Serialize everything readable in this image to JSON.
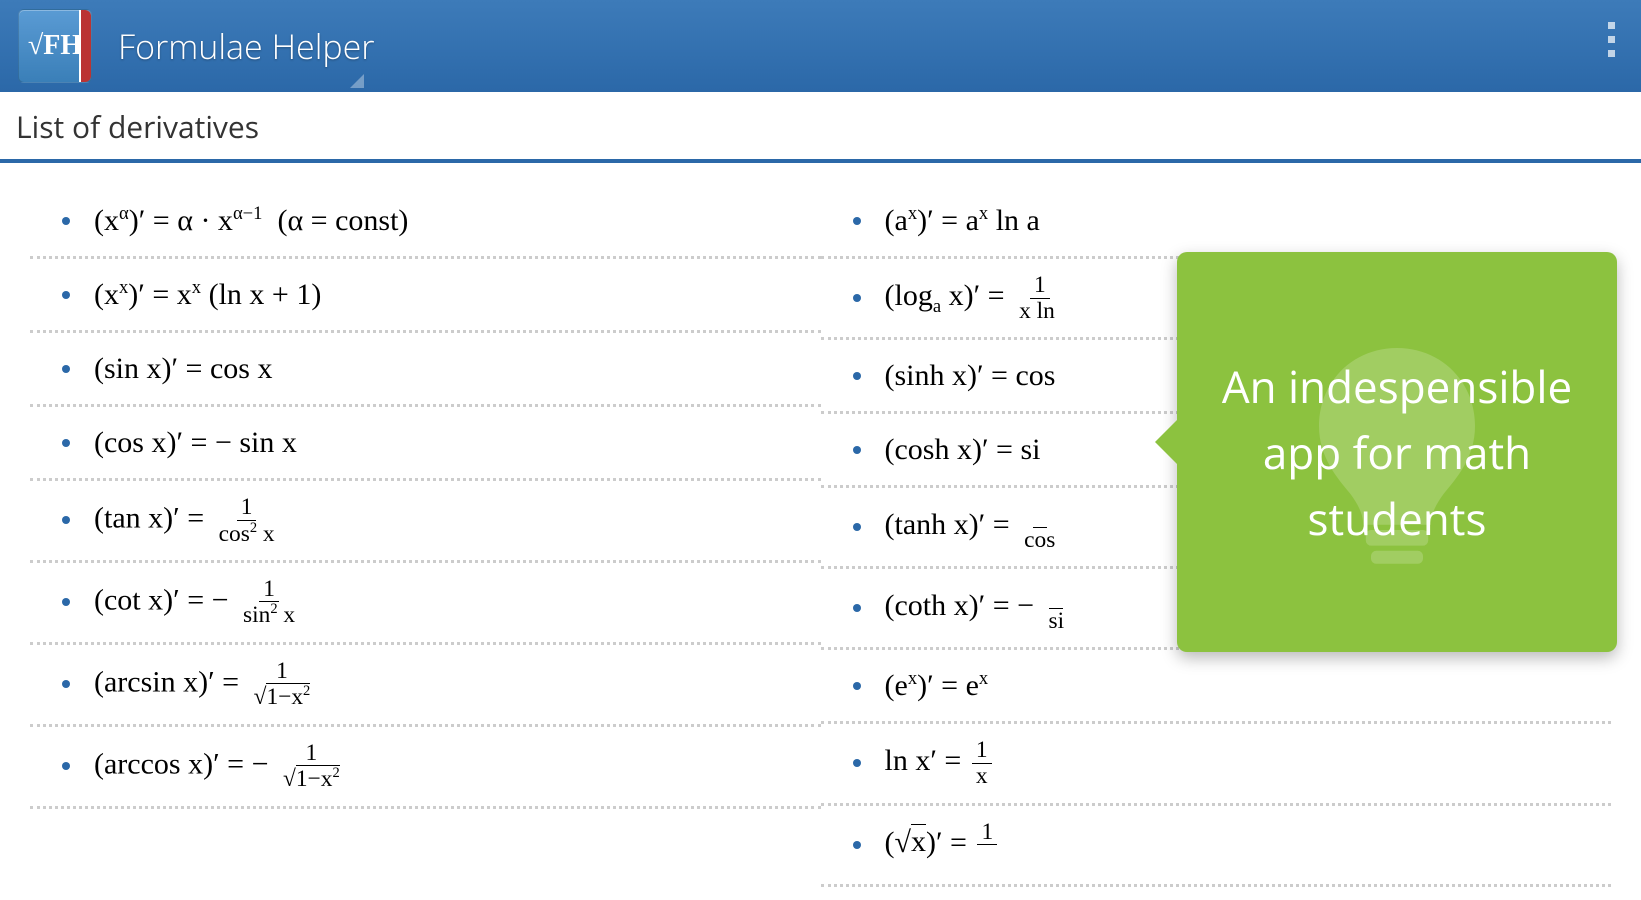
{
  "header": {
    "app_logo_text": "√FH",
    "app_title": "Formulae Helper"
  },
  "page": {
    "title": "List of derivatives"
  },
  "left_column": [
    {
      "html": "(x<span class='sup'>α</span>)′ = α · x<span class='sup'>α−1</span>&nbsp; (α = const)"
    },
    {
      "html": "(x<span class='sup'>x</span>)′ = x<span class='sup'>x</span> (ln x + 1)"
    },
    {
      "html": "(sin x)′ = cos x"
    },
    {
      "html": "(cos x)′ = − sin x"
    },
    {
      "html": "(tan x)′ = <span class='frac'><span class='num'>1</span><span class='den'>cos<span class='sup'>2</span> x</span></span>"
    },
    {
      "html": "(cot x)′ = − <span class='frac'><span class='num'>1</span><span class='den'>sin<span class='sup'>2</span> x</span></span>"
    },
    {
      "html": "(arcsin x)′ = <span class='frac'><span class='num'>1</span><span class='den'><span class='sqrt-sym'>√</span><span style='border-top:1.5px solid #000;'>1−x<span class=\"sup\">2</span></span></span></span>"
    },
    {
      "html": "(arccos x)′ = − <span class='frac'><span class='num'>1</span><span class='den'><span class='sqrt-sym'>√</span><span style='border-top:1.5px solid #000;'>1−x<span class=\"sup\">2</span></span></span></span>"
    }
  ],
  "right_column": [
    {
      "html": "(a<span class='sup'>x</span>)′ = a<span class='sup'>x</span> ln a"
    },
    {
      "html": "(log<span class='sub'>a</span> x)′ = <span class='frac'><span class='num'>1</span><span class='den'>x ln&nbsp;</span></span>"
    },
    {
      "html": "(sinh x)′ = cos"
    },
    {
      "html": "(cosh x)′ = si"
    },
    {
      "html": "(tanh x)′ = <span class='frac'><span class='num'>&nbsp;</span><span class='den'>cos</span></span>"
    },
    {
      "html": "(coth x)′ = − <span class='frac'><span class='num'>&nbsp;</span><span class='den'>si</span></span>"
    },
    {
      "html": "(e<span class='sup'>x</span>)′ = e<span class='sup'>x</span>"
    },
    {
      "html": "ln x′ = <span class='frac'><span class='num'>1</span><span class='den'>x</span></span>"
    },
    {
      "html": "(<span class='sqrt-sym'>√</span><span style='border-top:1.5px solid #000;'>x</span>)′ = <span class='frac'><span class='num'>1</span><span class='den'>&nbsp;</span></span>"
    }
  ],
  "callout": {
    "text": "An indespensible app for math students"
  }
}
